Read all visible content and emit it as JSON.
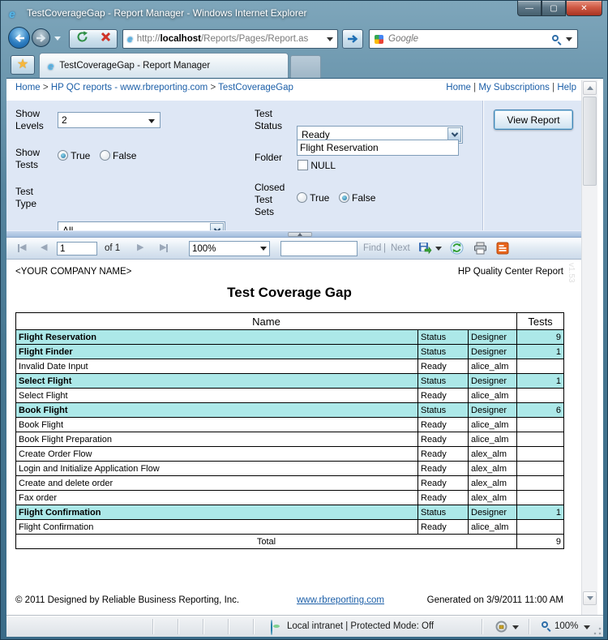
{
  "window": {
    "title": "TestCoverageGap - Report Manager - Windows Internet Explorer"
  },
  "nav": {
    "url_prefix": "http://",
    "url_host": "localhost",
    "url_path": "/Reports/Pages/Report.as",
    "search_placeholder": "Google"
  },
  "tab": {
    "title": "TestCoverageGap - Report Manager"
  },
  "breadcrumb": {
    "items": [
      "Home",
      "HP QC reports - www.rbreporting.com",
      "TestCoverageGap"
    ],
    "sep": ">",
    "links": [
      "Home",
      "My Subscriptions",
      "Help"
    ],
    "link_sep": "|"
  },
  "params": {
    "show_levels_label": "Show Levels",
    "show_levels_value": "2",
    "test_status_label": "Test Status",
    "test_status_value": "Ready",
    "show_tests_label": "Show Tests",
    "true_label": "True",
    "false_label": "False",
    "folder_label": "Folder",
    "folder_value": "Flight Reservation",
    "null_label": "NULL",
    "test_type_label": "Test Type",
    "test_type_value": "All",
    "closed_test_sets_label": "Closed Test Sets",
    "view_report_label": "View Report"
  },
  "toolbar": {
    "page_value": "1",
    "of_label": "of 1",
    "zoom_value": "100%",
    "find_label": "Find",
    "sep": "|",
    "next_label": "Next"
  },
  "report": {
    "company": "<YOUR COMPANY NAME>",
    "header_right": "HP Quality Center Report",
    "version": "v1.53",
    "title": "Test Coverage Gap",
    "table": {
      "name_header": "Name",
      "tests_header": "Tests",
      "rows": [
        {
          "name": "Flight Reservation",
          "indent": 0,
          "group": true,
          "status": "Status",
          "designer": "Designer",
          "tests": "9"
        },
        {
          "name": "Flight Finder",
          "indent": 1,
          "group": true,
          "status": "Status",
          "designer": "Designer",
          "tests": "1"
        },
        {
          "name": "Invalid Date Input",
          "indent": 2,
          "group": false,
          "status": "Ready",
          "designer": "alice_alm",
          "tests": ""
        },
        {
          "name": "Select Flight",
          "indent": 1,
          "group": true,
          "status": "Status",
          "designer": "Designer",
          "tests": "1"
        },
        {
          "name": "Select Flight",
          "indent": 2,
          "group": false,
          "status": "Ready",
          "designer": "alice_alm",
          "tests": ""
        },
        {
          "name": "Book Flight",
          "indent": 1,
          "group": true,
          "status": "Status",
          "designer": "Designer",
          "tests": "6"
        },
        {
          "name": "Book Flight",
          "indent": 2,
          "group": false,
          "status": "Ready",
          "designer": "alice_alm",
          "tests": ""
        },
        {
          "name": "Book Flight Preparation",
          "indent": 2,
          "group": false,
          "status": "Ready",
          "designer": "alice_alm",
          "tests": ""
        },
        {
          "name": "Create Order Flow",
          "indent": 2,
          "group": false,
          "status": "Ready",
          "designer": "alex_alm",
          "tests": ""
        },
        {
          "name": "Login and Initialize Application Flow",
          "indent": 2,
          "group": false,
          "status": "Ready",
          "designer": "alex_alm",
          "tests": ""
        },
        {
          "name": "Create and delete order",
          "indent": 2,
          "group": false,
          "status": "Ready",
          "designer": "alex_alm",
          "tests": ""
        },
        {
          "name": "Fax order",
          "indent": 2,
          "group": false,
          "status": "Ready",
          "designer": "alex_alm",
          "tests": ""
        },
        {
          "name": "Flight Confirmation",
          "indent": 1,
          "group": true,
          "status": "Status",
          "designer": "Designer",
          "tests": "1"
        },
        {
          "name": "Flight Confirmation",
          "indent": 2,
          "group": false,
          "status": "Ready",
          "designer": "alice_alm",
          "tests": ""
        }
      ],
      "total_label": "Total",
      "total_value": "9"
    },
    "footer": {
      "copyright": "© 2011 Designed by Reliable Business Reporting, Inc.",
      "link": "www.rbreporting.com",
      "generated": "Generated on 3/9/2011 11:00 AM"
    }
  },
  "statusbar": {
    "zone": "Local intranet | Protected Mode: Off",
    "zoom": "100%"
  },
  "colors": {
    "row_cyan": "#ace8e8",
    "link_blue": "#1c5fa8"
  }
}
